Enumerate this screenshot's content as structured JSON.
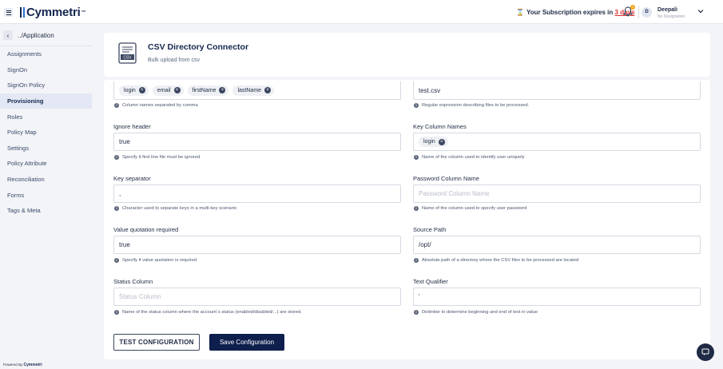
{
  "header": {
    "logo_text": "Cymmetri",
    "logo_tm": "™",
    "subscription_prefix": "Your Subscription expires in",
    "subscription_days": "3 days",
    "notification_count": "1",
    "user_initial": "D",
    "user_name": "Deepali",
    "user_role": "No Designation"
  },
  "sidebar": {
    "back_label": "../Application",
    "items": [
      {
        "label": "Assignments"
      },
      {
        "label": "SignOn"
      },
      {
        "label": "SignOn Policy"
      },
      {
        "label": "Provisioning"
      },
      {
        "label": "Roles"
      },
      {
        "label": "Policy Map"
      },
      {
        "label": "Settings"
      },
      {
        "label": "Policy Attribute"
      },
      {
        "label": "Reconciliation"
      },
      {
        "label": "Forms"
      },
      {
        "label": "Tags & Meta"
      }
    ],
    "active_item": "Provisioning",
    "powered_by_prefix": "Powered By",
    "powered_by_brand": "Cymmetri"
  },
  "connector": {
    "icon_label": "CSV",
    "title": "CSV Directory Connector",
    "subtitle": "Bulk upload from csv"
  },
  "form": {
    "fields": [
      {
        "id": "headers",
        "label": "",
        "chips": [
          "login",
          "email",
          "firstName",
          "lastName"
        ],
        "help": "Column names separated by comma"
      },
      {
        "id": "file_mask",
        "label": "",
        "value": "test.csv",
        "help": "Regular expression describing files to be processed."
      },
      {
        "id": "ignore_header",
        "label": "Ignore header",
        "value": "true",
        "help": "Specify it first line file must be ignored"
      },
      {
        "id": "key_columns",
        "label": "Key Column Names",
        "chips": [
          "login"
        ],
        "help": "Name of the column used to identify user uniquely"
      },
      {
        "id": "key_separator",
        "label": "Key separator",
        "value": ",",
        "help": "Character used to separate keys in a multi-key scenario"
      },
      {
        "id": "password_column",
        "label": "Password Column Name",
        "placeholder": "Password Column Name",
        "help": "Name of the column used to specify user password"
      },
      {
        "id": "value_quotation",
        "label": "Value quotation required",
        "value": "true",
        "help": "Specify if value quotation is required"
      },
      {
        "id": "source_path",
        "label": "Source Path",
        "value": "/opt/",
        "help": "Absolute path of a directory where the CSV files to be processed are located"
      },
      {
        "id": "status_column",
        "label": "Status Column",
        "placeholder": "Status Column",
        "help": "Name of the status column where the account`s status (enabled/disabled/...) are stored."
      },
      {
        "id": "text_qualifier",
        "label": "Text Qualifier",
        "value": "'",
        "help": "Delimiter to determine beginning and end of text in value"
      }
    ],
    "test_button": "TEST CONFIGURATION",
    "save_button": "Save Configuration"
  },
  "colors": {
    "primary": "#0e1f4d",
    "alert": "#e03131",
    "badge": "#f2a31b"
  },
  "icons": {
    "menu": "hamburger-icon",
    "hourglass": "hourglass-icon",
    "bell": "bell-icon",
    "chevron": "chevron-down-icon",
    "back": "chevron-left-icon",
    "chip_remove": "close-circle-icon",
    "help": "info-icon",
    "fab": "chat-icon"
  }
}
